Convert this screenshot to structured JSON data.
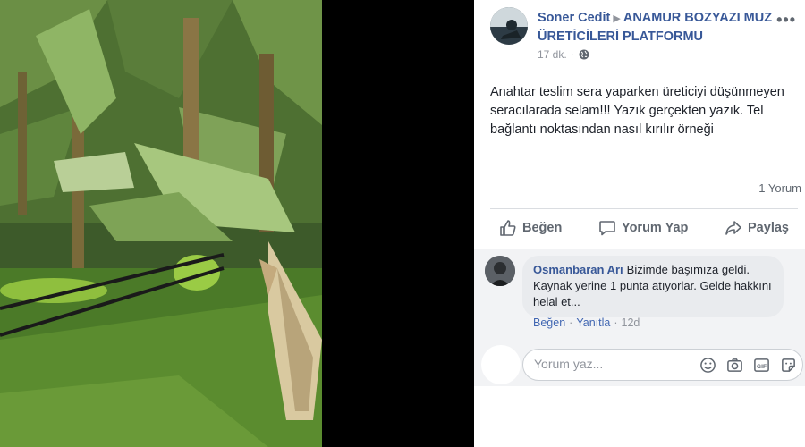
{
  "post": {
    "author": "Soner Cedit",
    "group": "ANAMUR BOZYAZI MUZ ÜRETİCİLERİ PLATFORMU",
    "time": "17 dk.",
    "text": "Anahtar teslim sera yaparken üreticiyi düşünmeyen seracılarada selam!!! Yazık gerçekten yazık. Tel bağlantı noktasından nasıl kırılır örneği",
    "comment_count": "1 Yorum"
  },
  "actions": {
    "like": "Beğen",
    "comment": "Yorum Yap",
    "share": "Paylaş"
  },
  "comment": {
    "author": "Osmanbaran Arı",
    "text": "Bizimde başımıza geldi. Kaynak yerine 1 punta atıyorlar. Gelde hakkını helal et...",
    "like": "Beğen",
    "reply": "Yanıtla",
    "time": "12d"
  },
  "reply_box": {
    "placeholder": "Yorum yaz..."
  },
  "icons": [
    "more-icon",
    "globe-icon",
    "like-icon",
    "comment-icon",
    "share-icon",
    "emoji-icon",
    "camera-icon",
    "gif-icon",
    "sticker-icon"
  ]
}
